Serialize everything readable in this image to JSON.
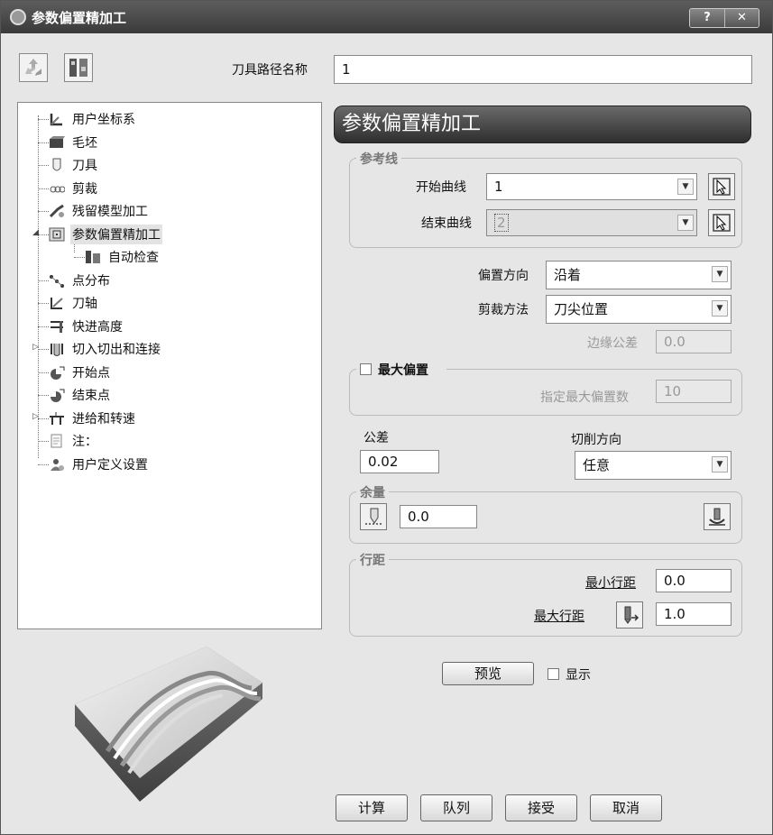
{
  "window": {
    "title": "参数偏置精加工",
    "help_label": "?",
    "close_label": "✕"
  },
  "toolbar": {
    "path_name_label": "刀具路径名称",
    "path_name_value": "1"
  },
  "tree": [
    {
      "label": "用户坐标系",
      "icon": "ucs-icon"
    },
    {
      "label": "毛坯",
      "icon": "block-icon"
    },
    {
      "label": "刀具",
      "icon": "tool-icon"
    },
    {
      "label": "剪裁",
      "icon": "trim-icon"
    },
    {
      "label": "残留模型加工",
      "icon": "rest-model-icon"
    },
    {
      "label": "参数偏置精加工",
      "icon": "offset-finish-icon"
    },
    {
      "label": "自动检查",
      "icon": "auto-check-icon"
    },
    {
      "label": "点分布",
      "icon": "point-distribution-icon"
    },
    {
      "label": "刀轴",
      "icon": "tool-axis-icon"
    },
    {
      "label": "快进高度",
      "icon": "rapid-height-icon"
    },
    {
      "label": "切入切出和连接",
      "icon": "leads-links-icon"
    },
    {
      "label": "开始点",
      "icon": "start-point-icon"
    },
    {
      "label": "结束点",
      "icon": "end-point-icon"
    },
    {
      "label": "进给和转速",
      "icon": "feeds-speeds-icon"
    },
    {
      "label": "注：",
      "icon": "notes-icon"
    },
    {
      "label": "用户定义设置",
      "icon": "user-settings-icon"
    }
  ],
  "panel": {
    "header": "参数偏置精加工",
    "reference": {
      "group_title": "参考线",
      "start_curve_label": "开始曲线",
      "start_curve_value": "1",
      "end_curve_label": "结束曲线",
      "end_curve_value": "2"
    },
    "offset_direction_label": "偏置方向",
    "offset_direction_value": "沿着",
    "trim_method_label": "剪裁方法",
    "trim_method_value": "刀尖位置",
    "edge_tolerance_label": "边缘公差",
    "edge_tolerance_value": "0.0",
    "max_offset": {
      "label": "最大偏置",
      "count_label": "指定最大偏置数",
      "count_value": "10"
    },
    "tolerance_label": "公差",
    "tolerance_value": "0.02",
    "cut_direction_label": "切削方向",
    "cut_direction_value": "任意",
    "thickness": {
      "group_title": "余量",
      "value": "0.0"
    },
    "stepover": {
      "group_title": "行距",
      "min_label": "最小行距",
      "min_value": "0.0",
      "max_label": "最大行距",
      "max_value": "1.0"
    },
    "preview_label": "预览",
    "show_label": "显示"
  },
  "footer": {
    "calculate": "计算",
    "queue": "队列",
    "accept": "接受",
    "cancel": "取消"
  }
}
